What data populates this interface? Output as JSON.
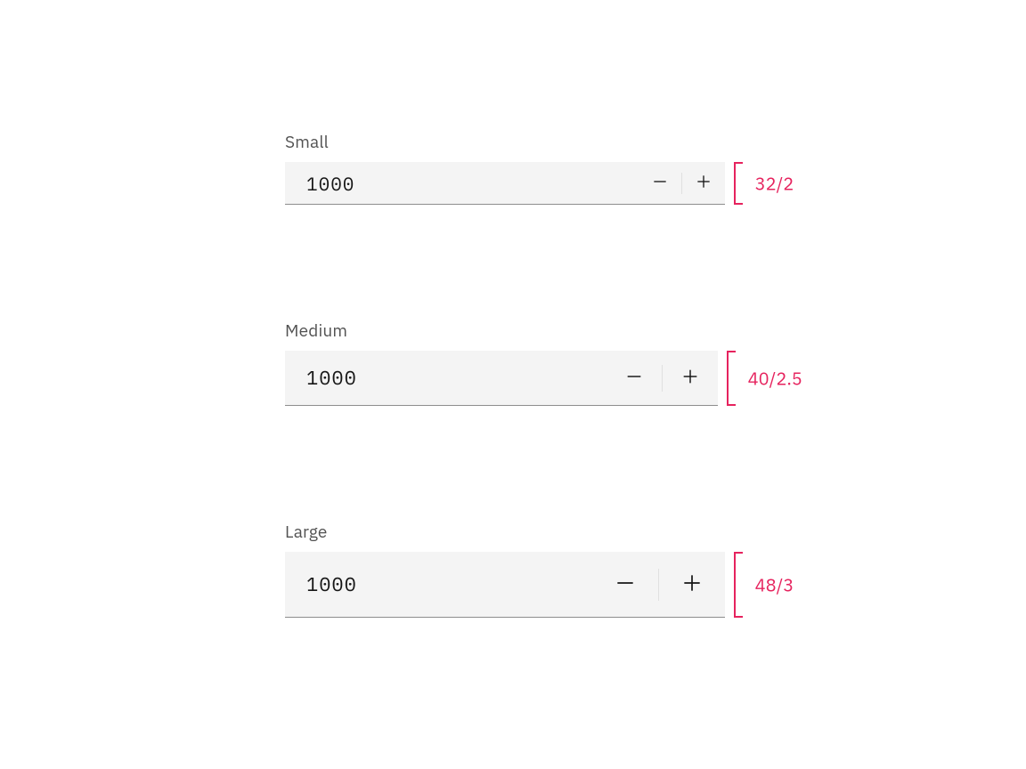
{
  "variants": [
    {
      "key": "sm",
      "label": "Small",
      "value": "1000",
      "annotation": "32/2"
    },
    {
      "key": "md",
      "label": "Medium",
      "value": "1000",
      "annotation": "40/2.5"
    },
    {
      "key": "lg",
      "label": "Large",
      "value": "1000",
      "annotation": "48/3"
    }
  ],
  "colors": {
    "annotation": "#e6235e",
    "input_bg": "#f4f4f4",
    "border": "#8d8d8d"
  }
}
